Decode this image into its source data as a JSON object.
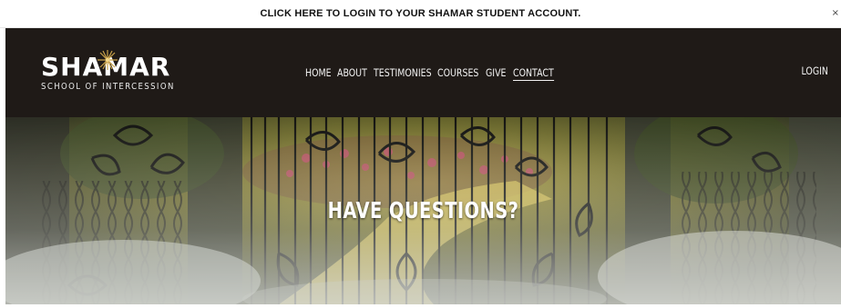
{
  "announcement": {
    "text": "CLICK HERE TO LOGIN TO YOUR SHAMAR STUDENT ACCOUNT.",
    "close": "×"
  },
  "brand": {
    "name": "SHAMAR",
    "tagline": "SCHOOL OF INTERCESSION",
    "accent": "#c9a24a"
  },
  "nav": {
    "items": [
      {
        "label": "HOME"
      },
      {
        "label": "ABOUT"
      },
      {
        "label": "TESTIMONIES"
      },
      {
        "label": "COURSES"
      },
      {
        "label": "GIVE"
      },
      {
        "label": "CONTACT",
        "active": true
      }
    ],
    "login": "LOGIN"
  },
  "hero": {
    "title": "HAVE QUESTIONS?"
  },
  "colors": {
    "header_bg": "#1f1a17",
    "announce_bg": "#ffffff",
    "text_light": "#f2f2f2"
  }
}
